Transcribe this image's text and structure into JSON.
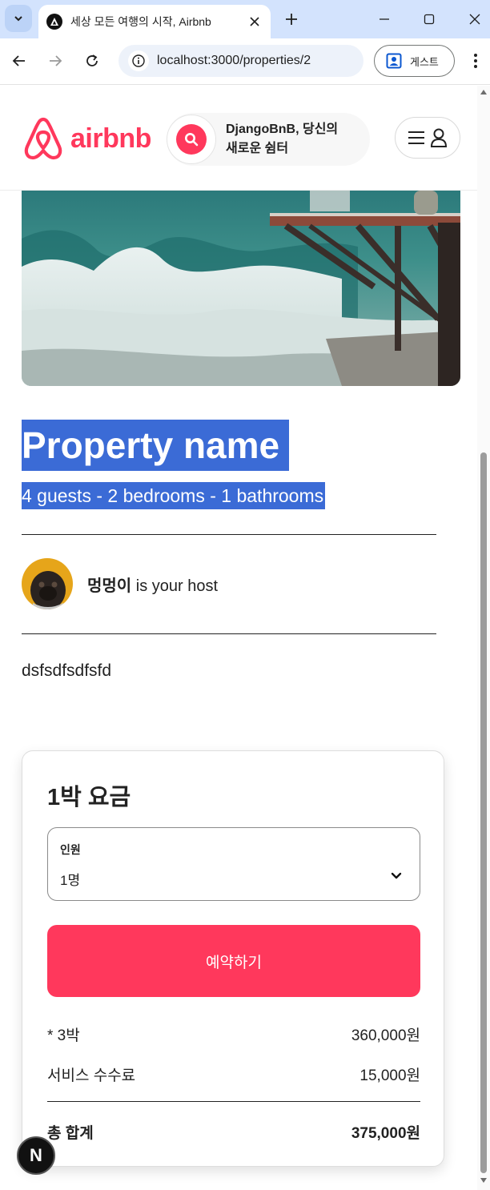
{
  "browser": {
    "tab_title": "세상 모든 여행의 시작, Airbnb",
    "url": "localhost:3000/properties/2",
    "profile_label": "게스트"
  },
  "header": {
    "logo_text": "airbnb",
    "tagline_line1": "DjangoBnB, 당신의",
    "tagline_line2": "새로운 쉼터"
  },
  "listing": {
    "name": "Property name",
    "specs": "4 guests - 2 bedrooms - 1 bathrooms",
    "host_name": "멍멍이",
    "host_suffix": " is your host",
    "description": "dsfsdfsdfsfd"
  },
  "booking": {
    "title": "1박 요금",
    "guests_label": "인원",
    "guests_value": "1명",
    "reserve_label": "예약하기",
    "nights_label": "* 3박",
    "nights_price": "360,000원",
    "fee_label": "서비스 수수료",
    "fee_price": "15,000원",
    "total_label": "총 합계",
    "total_price": "375,000원"
  },
  "dev_badge": "N",
  "colors": {
    "brand": "#ff385c",
    "selection": "#3b6bd6",
    "chrome_tabbar": "#d3e3fd"
  }
}
